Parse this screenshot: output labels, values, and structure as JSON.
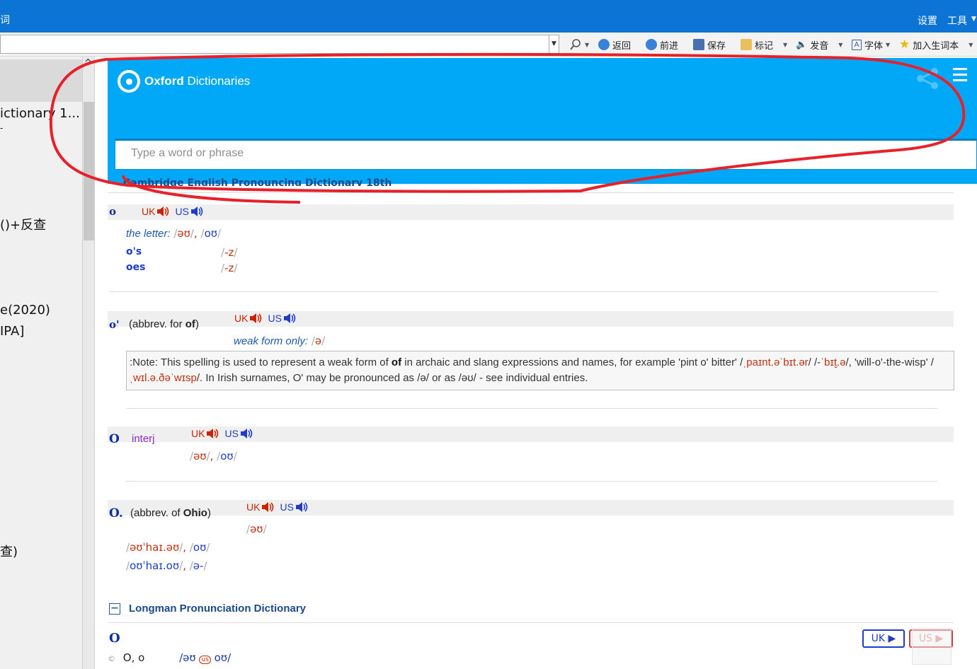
{
  "titlebar": {
    "left_text": "词",
    "menu_settings": "设置",
    "menu_tools": "工具"
  },
  "toolbar": {
    "back": "返回",
    "forward": "前进",
    "save": "保存",
    "mark": "标记",
    "speak": "发音",
    "font": "字体",
    "add_vocab": "加入生词本"
  },
  "leftpane": {
    "items": [
      "ictionary 1...",
      "-",
      "()+反查",
      "e(2020)",
      "IPA]",
      "查)"
    ]
  },
  "oxford": {
    "brand_bold": "Oxford",
    "brand_rest": "Dictionaries",
    "search_placeholder": "Type a word or phrase"
  },
  "cpd": {
    "cut_header": "Cambridge English Pronouncing Dictionary 18th",
    "entries": {
      "o": {
        "headword": "o",
        "uk": "UK",
        "us": "US",
        "label": "the letter:",
        "uk_ipa": "əʊ",
        "us_ipa": "oʊ",
        "infl1_form": "o's",
        "infl1_ipa": "-z",
        "infl2_form": "oes",
        "infl2_ipa": "-z"
      },
      "o_apos": {
        "headword": "o'",
        "abbr_pre": "(abbrev. for ",
        "abbr_word": "of",
        "abbr_post": ")",
        "uk": "UK",
        "us": "US",
        "label": "weak form only:",
        "ipa": "ə",
        "note_a": ":Note: This spelling is used to represent a weak form of ",
        "note_b": "of",
        "note_c": " in archaic and slang expressions and names, for example 'pint o' bitter' /",
        "note_ipa1": "ˌpaɪnt.əˈbɪt.ər",
        "note_d": "/ /-",
        "note_ipa2": "ˈbɪt̬.ə",
        "note_e": "/, 'will-o'-the-wisp' /",
        "note_ipa3": "ˌwɪl.ə.ðəˈwɪsp",
        "note_f": "/. In Irish surnames, O' may be pronounced as /ə/ or as /əʊ/ - see individual entries."
      },
      "O_interj": {
        "headword": "O",
        "pos": "interj",
        "uk": "UK",
        "us": "US",
        "uk_ipa": "əʊ",
        "us_ipa": "oʊ"
      },
      "O_ohio": {
        "headword": "O.",
        "abbr_pre": "(abbrev. of ",
        "abbr_word": "Ohio",
        "abbr_post": ")",
        "uk": "UK",
        "us": "US",
        "ipa": "əʊ",
        "full_uk": "əʊˈhaɪ.əʊ",
        "full_us": "oʊ",
        "full_us2": "oʊˈhaɪ.oʊ",
        "full_us2b": "ə-"
      }
    }
  },
  "lpd": {
    "title": "Longman Pronunciation Dictionary",
    "headword": "O",
    "btn_uk": "UK ▶",
    "btn_us": "US ▶",
    "row_copy": "©",
    "row_forms": "O, o",
    "row_uk": "əʊ",
    "row_badge": "us",
    "row_us": "oʊ"
  },
  "colors": {
    "titlebar": "#0b74d5",
    "oxford_blue": "#00a8f7",
    "headword": "#0a2ea8",
    "uk_red": "#cc2200",
    "us_blue": "#1e3cc8",
    "annotation_red": "#e8202a"
  },
  "icons": [
    "speaker-icon",
    "search-icon",
    "back-icon",
    "forward-icon",
    "save-icon",
    "mark-icon",
    "font-icon",
    "star-icon",
    "share-icon",
    "menu-icon"
  ]
}
